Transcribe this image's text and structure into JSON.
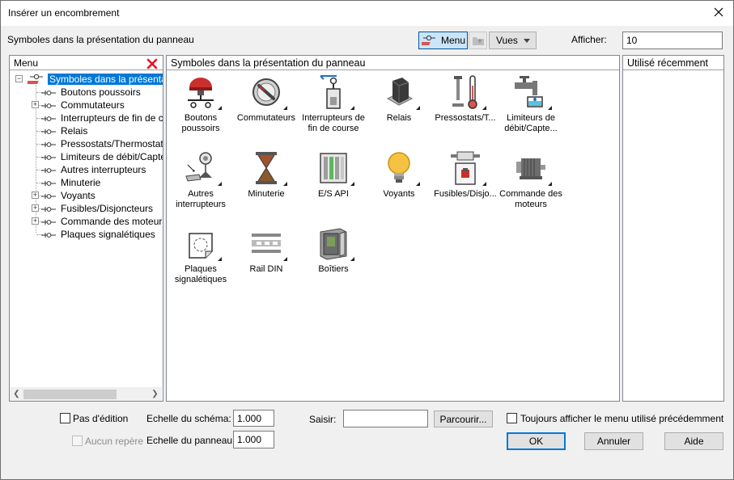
{
  "window": {
    "title": "Insérer un encombrement"
  },
  "toolbar": {
    "label": "Symboles dans la présentation du panneau",
    "menu_button": "Menu",
    "views_button": "Vues",
    "show_label": "Afficher:",
    "show_value": "10"
  },
  "menu_panel": {
    "title": "Menu",
    "tree": [
      {
        "label": "Symboles dans la présentation",
        "expander": "−",
        "selected": true
      },
      {
        "label": "Boutons poussoirs"
      },
      {
        "label": "Commutateurs",
        "expander": "+"
      },
      {
        "label": "Interrupteurs de fin de cour"
      },
      {
        "label": "Relais"
      },
      {
        "label": "Pressostats/Thermostats"
      },
      {
        "label": "Limiteurs de débit/Capteurs"
      },
      {
        "label": "Autres interrupteurs"
      },
      {
        "label": "Minuterie"
      },
      {
        "label": "Voyants",
        "expander": "+"
      },
      {
        "label": "Fusibles/Disjoncteurs",
        "expander": "+"
      },
      {
        "label": "Commande des moteurs",
        "expander": "+"
      },
      {
        "label": "Plaques signalétiques"
      }
    ]
  },
  "symbols_panel": {
    "title": "Symboles dans la présentation du panneau",
    "items": [
      {
        "label": "Boutons poussoirs",
        "icon": "push-button-icon"
      },
      {
        "label": "Commutateurs",
        "icon": "selector-switch-icon"
      },
      {
        "label": "Interrupteurs de fin de course",
        "icon": "limit-switch-icon"
      },
      {
        "label": "Relais",
        "icon": "relay-icon"
      },
      {
        "label": "Pressostats/T...",
        "icon": "thermometer-icon"
      },
      {
        "label": "Limiteurs de débit/Capte...",
        "icon": "faucet-icon"
      },
      {
        "label": "Autres interrupteurs",
        "icon": "other-switch-icon"
      },
      {
        "label": "Minuterie",
        "icon": "hourglass-icon"
      },
      {
        "label": "E/S API",
        "icon": "plc-io-icon"
      },
      {
        "label": "Voyants",
        "icon": "light-bulb-icon"
      },
      {
        "label": "Fusibles/Disjo...",
        "icon": "fuse-icon"
      },
      {
        "label": "Commande des moteurs",
        "icon": "motor-icon"
      },
      {
        "label": "Plaques signalétiques",
        "icon": "nameplate-icon"
      },
      {
        "label": "Rail DIN",
        "icon": "din-rail-icon"
      },
      {
        "label": "Boîtiers",
        "icon": "enclosure-icon"
      }
    ]
  },
  "recent_panel": {
    "title": "Utilisé récemment"
  },
  "footer": {
    "no_edit": "Pas d'édition",
    "no_marker": "Aucun repère",
    "schema_scale_label": "Echelle du schéma:",
    "schema_scale_value": "1.000",
    "panel_scale_label": "Echelle du panneau:",
    "panel_scale_value": "1.000",
    "enter_label": "Saisir:",
    "enter_value": "",
    "browse_button": "Parcourir...",
    "always_show": "Toujours afficher le menu utilisé précédemment",
    "ok_button": "OK",
    "cancel_button": "Annuler",
    "help_button": "Aide"
  },
  "colors": {
    "accent": "#0078d7",
    "close_icon_red": "#e81123"
  }
}
